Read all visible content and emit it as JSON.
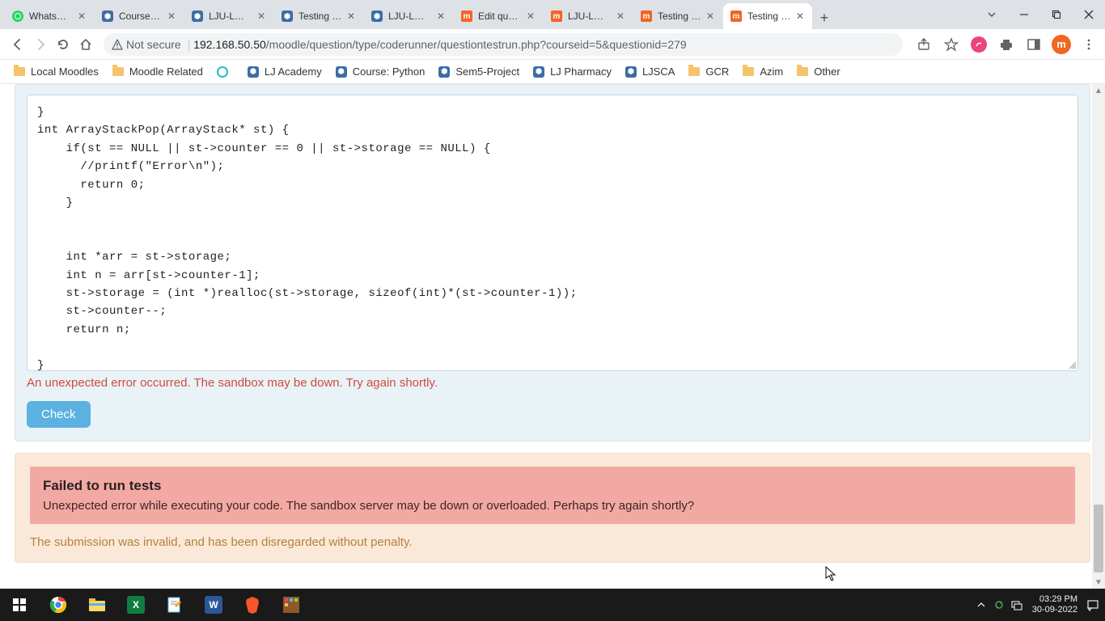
{
  "tabs": [
    {
      "title": "WhatsApp",
      "iconType": "whatsapp"
    },
    {
      "title": "Course: Se…",
      "iconType": "moodle-blue"
    },
    {
      "title": "LJU-LMS: …",
      "iconType": "moodle-blue"
    },
    {
      "title": "Testing qu…",
      "iconType": "moodle-blue"
    },
    {
      "title": "LJU-LMS: …",
      "iconType": "moodle-blue"
    },
    {
      "title": "Edit questi…",
      "iconType": "moodle-m"
    },
    {
      "title": "LJU-LMS: …",
      "iconType": "moodle-m"
    },
    {
      "title": "Testing qu…",
      "iconType": "moodle-m"
    },
    {
      "title": "Testing qu…",
      "iconType": "moodle-m",
      "active": true
    }
  ],
  "address": {
    "secureLabel": "Not secure",
    "url_host": "192.168.50.50",
    "url_path": "/moodle/question/type/coderunner/questiontestrun.php?courseid=5&questionid=279",
    "avatarLetter": "m"
  },
  "bookmarks": [
    {
      "label": "Local Moodles",
      "iconType": "folder"
    },
    {
      "label": "Moodle Related",
      "iconType": "folder"
    },
    {
      "label": "",
      "iconType": "cyan"
    },
    {
      "label": "LJ Academy",
      "iconType": "moodle-blue"
    },
    {
      "label": "Course: Python",
      "iconType": "moodle-blue"
    },
    {
      "label": "Sem5-Project",
      "iconType": "moodle-blue"
    },
    {
      "label": "LJ Pharmacy",
      "iconType": "moodle-blue"
    },
    {
      "label": "LJSCA",
      "iconType": "moodle-blue"
    },
    {
      "label": "GCR",
      "iconType": "folder"
    },
    {
      "label": "Azim",
      "iconType": "folder"
    },
    {
      "label": "Other",
      "iconType": "folder"
    }
  ],
  "code": "}\nint ArrayStackPop(ArrayStack* st) {\n    if(st == NULL || st->counter == 0 || st->storage == NULL) {\n      //printf(\"Error\\n\");\n      return 0;\n    }\n\n\n    int *arr = st->storage;\n    int n = arr[st->counter-1];\n    st->storage = (int *)realloc(st->storage, sizeof(int)*(st->counter-1));\n    st->counter--;\n    return n;\n\n}",
  "errorLine": "An unexpected error occurred. The sandbox may be down. Try again shortly.",
  "checkLabel": "Check",
  "failTitle": "Failed to run tests",
  "failMsg": "Unexpected error while executing your code. The sandbox server may be down or overloaded. Perhaps try again shortly?",
  "disregardMsg": "The submission was invalid, and has been disregarded without penalty.",
  "clock": {
    "time": "03:29 PM",
    "date": "30-09-2022"
  }
}
